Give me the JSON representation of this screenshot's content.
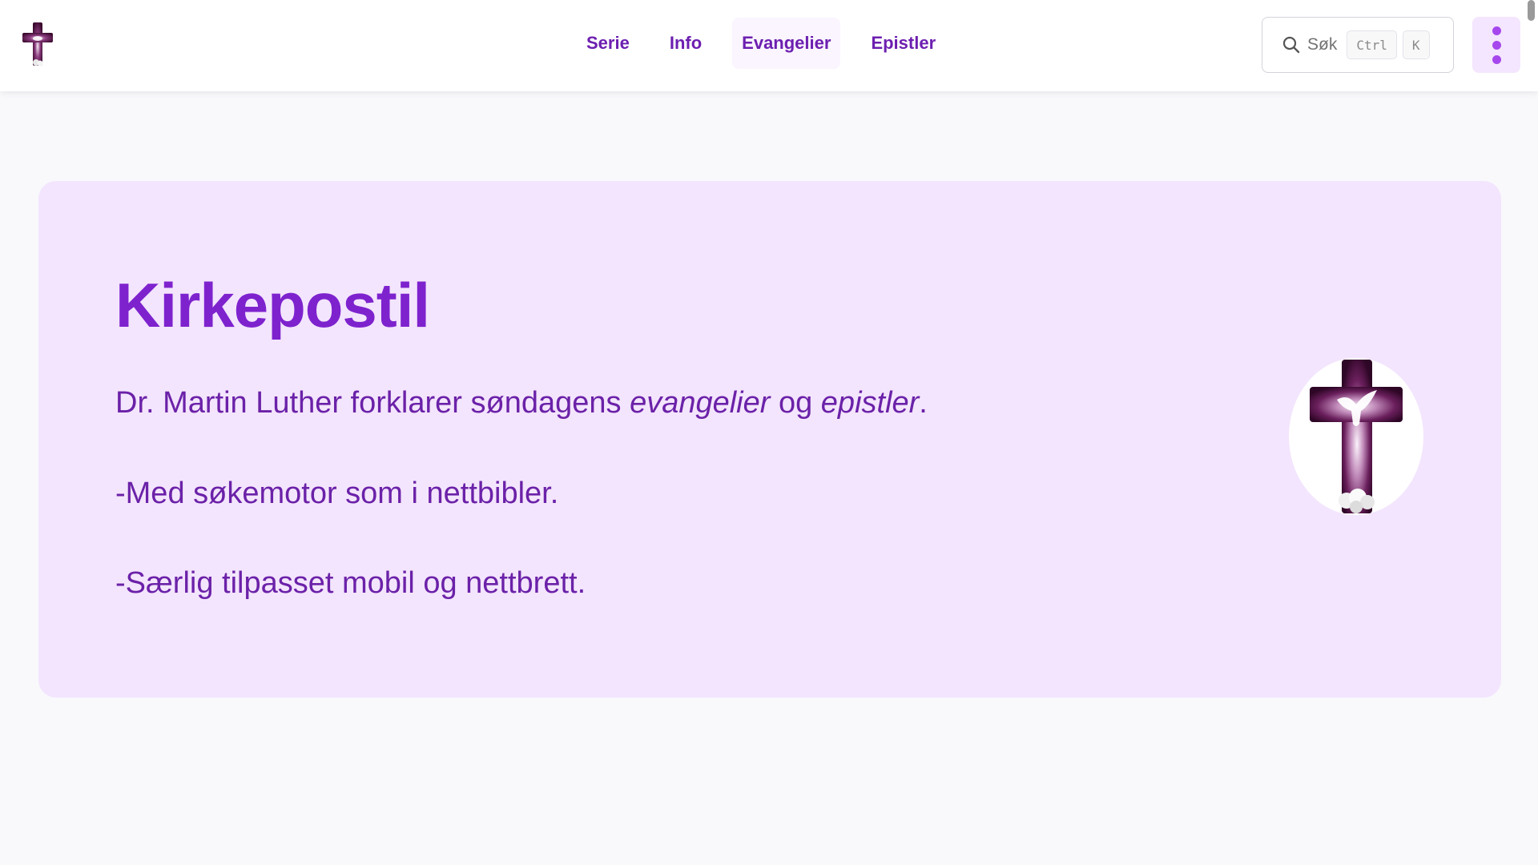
{
  "header": {
    "logo": "cross-logo",
    "nav": [
      {
        "label": "Serie",
        "active": false
      },
      {
        "label": "Info",
        "active": false
      },
      {
        "label": "Evangelier",
        "active": true
      },
      {
        "label": "Epistler",
        "active": false
      }
    ],
    "search": {
      "icon": "search-icon",
      "label": "Søk",
      "shortcut_keys": [
        "Ctrl",
        "K"
      ]
    },
    "menu_icon": "vertical-dots-icon"
  },
  "hero": {
    "title": "Kirkepostil",
    "intro": {
      "before": "Dr. Martin Luther forklarer søndagens ",
      "em1": "evangelier",
      "middle": " og ",
      "em2": "epistler",
      "after": "."
    },
    "line2": "-Med søkemotor som i nettbibler.",
    "line3": "-Særlig tilpasset mobil og nettbrett.",
    "image": "cross-with-dove-image"
  },
  "colors": {
    "accent": "#7e22ce",
    "text": "#6b21a8",
    "card_bg": "#f3e5fd",
    "page_bg": "#f9f9fc",
    "menu_bg": "#f4e6fe"
  }
}
